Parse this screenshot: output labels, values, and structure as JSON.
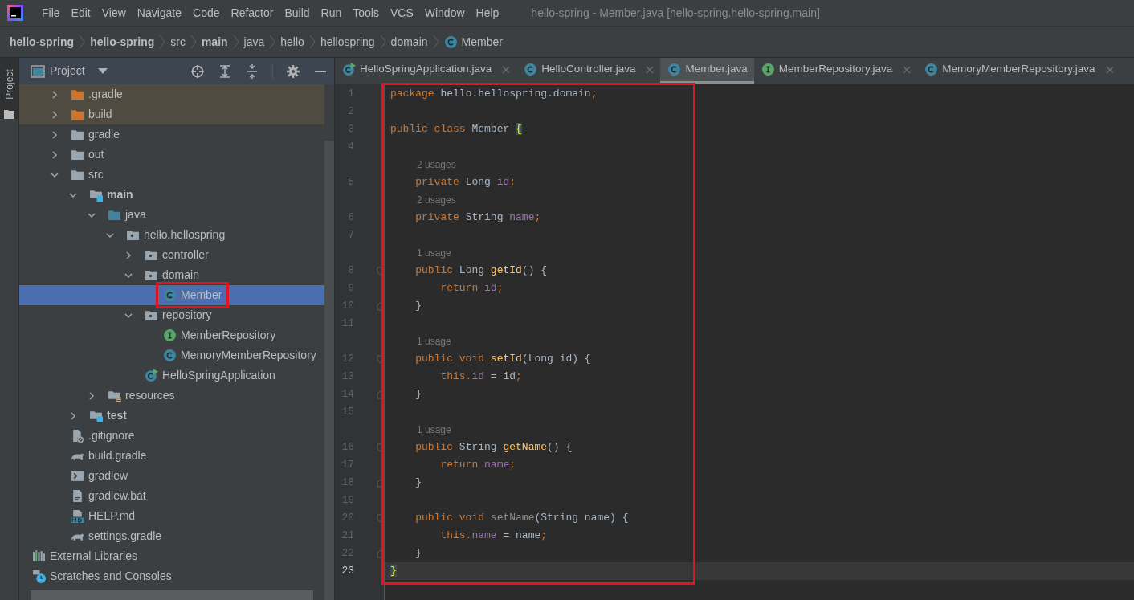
{
  "window": {
    "title": "hello-spring - Member.java [hello-spring.hello-spring.main]"
  },
  "menu": [
    "File",
    "Edit",
    "View",
    "Navigate",
    "Code",
    "Refactor",
    "Build",
    "Run",
    "Tools",
    "VCS",
    "Window",
    "Help"
  ],
  "breadcrumbs": [
    {
      "label": "hello-spring",
      "bold": true,
      "kind": "plain"
    },
    {
      "label": "hello-spring",
      "bold": true,
      "kind": "plain"
    },
    {
      "label": "src",
      "bold": false,
      "kind": "plain"
    },
    {
      "label": "main",
      "bold": true,
      "kind": "plain"
    },
    {
      "label": "java",
      "bold": false,
      "kind": "plain"
    },
    {
      "label": "hello",
      "bold": false,
      "kind": "plain"
    },
    {
      "label": "hellospring",
      "bold": false,
      "kind": "plain"
    },
    {
      "label": "domain",
      "bold": false,
      "kind": "plain"
    },
    {
      "label": "Member",
      "bold": false,
      "kind": "class"
    }
  ],
  "side_tab": {
    "label": "Project",
    "selected": true
  },
  "project_panel": {
    "title": "Project",
    "items": [
      {
        "label": ".gradle",
        "kind": "folder_excluded",
        "bold": false,
        "excluded": true,
        "selected": false,
        "framed": false,
        "expanded": false
      },
      {
        "label": "build",
        "kind": "folder_excluded",
        "bold": false,
        "excluded": true,
        "selected": false,
        "framed": false,
        "expanded": false
      },
      {
        "label": "gradle",
        "kind": "folder",
        "bold": false,
        "excluded": false,
        "selected": false,
        "framed": false,
        "expanded": false
      },
      {
        "label": "out",
        "kind": "folder",
        "bold": false,
        "excluded": false,
        "selected": false,
        "framed": false,
        "expanded": false
      },
      {
        "label": "src",
        "kind": "folder",
        "bold": false,
        "excluded": false,
        "selected": false,
        "framed": false,
        "expanded": true,
        "children": [
          {
            "label": "main",
            "kind": "folder_source",
            "bold": true,
            "excluded": false,
            "selected": false,
            "framed": false,
            "expanded": true,
            "children": [
              {
                "label": "java",
                "kind": "folder_java",
                "bold": false,
                "excluded": false,
                "selected": false,
                "framed": false,
                "expanded": true,
                "children": [
                  {
                    "label": "hello.hellospring",
                    "kind": "package",
                    "bold": false,
                    "excluded": false,
                    "selected": false,
                    "framed": false,
                    "expanded": true,
                    "children": [
                      {
                        "label": "controller",
                        "kind": "package",
                        "bold": false,
                        "excluded": false,
                        "selected": false,
                        "framed": false,
                        "expanded": false
                      },
                      {
                        "label": "domain",
                        "kind": "package",
                        "bold": false,
                        "excluded": false,
                        "selected": false,
                        "framed": false,
                        "expanded": true,
                        "children": [
                          {
                            "label": "Member",
                            "kind": "class",
                            "bold": false,
                            "excluded": false,
                            "selected": true,
                            "framed": true
                          }
                        ]
                      },
                      {
                        "label": "repository",
                        "kind": "package",
                        "bold": false,
                        "excluded": false,
                        "selected": false,
                        "framed": false,
                        "expanded": true,
                        "children": [
                          {
                            "label": "MemberRepository",
                            "kind": "interface",
                            "bold": false,
                            "excluded": false,
                            "selected": false,
                            "framed": false
                          },
                          {
                            "label": "MemoryMemberRepository",
                            "kind": "class",
                            "bold": false,
                            "excluded": false,
                            "selected": false,
                            "framed": false
                          }
                        ]
                      },
                      {
                        "label": "HelloSpringApplication",
                        "kind": "class_run",
                        "bold": false,
                        "excluded": false,
                        "selected": false,
                        "framed": false
                      }
                    ]
                  }
                ]
              },
              {
                "label": "resources",
                "kind": "folder_resources",
                "bold": false,
                "excluded": false,
                "selected": false,
                "framed": false,
                "expanded": false
              }
            ]
          },
          {
            "label": "test",
            "kind": "folder_source",
            "bold": true,
            "excluded": false,
            "selected": false,
            "framed": false,
            "expanded": false
          }
        ]
      },
      {
        "label": ".gitignore",
        "kind": "gitignore",
        "bold": false,
        "excluded": false,
        "selected": false,
        "framed": false
      },
      {
        "label": "build.gradle",
        "kind": "gradle",
        "bold": false,
        "excluded": false,
        "selected": false,
        "framed": false
      },
      {
        "label": "gradlew",
        "kind": "shell",
        "bold": false,
        "excluded": false,
        "selected": false,
        "framed": false
      },
      {
        "label": "gradlew.bat",
        "kind": "text_file",
        "bold": false,
        "excluded": false,
        "selected": false,
        "framed": false
      },
      {
        "label": "HELP.md",
        "kind": "markdown",
        "bold": false,
        "excluded": false,
        "selected": false,
        "framed": false
      },
      {
        "label": "settings.gradle",
        "kind": "gradle",
        "bold": false,
        "excluded": false,
        "selected": false,
        "framed": false
      }
    ],
    "top_level_items": [
      {
        "label": "External Libraries",
        "kind": "libraries"
      },
      {
        "label": "Scratches and Consoles",
        "kind": "scratches"
      }
    ]
  },
  "tabs": [
    {
      "label": "HelloSpringApplication.java",
      "kind": "class_run",
      "selected": false,
      "show_close": true
    },
    {
      "label": "HelloController.java",
      "kind": "class",
      "selected": false,
      "show_close": true
    },
    {
      "label": "Member.java",
      "kind": "class",
      "selected": true,
      "show_close": false
    },
    {
      "label": "MemberRepository.java",
      "kind": "interface",
      "selected": false,
      "show_close": true
    },
    {
      "label": "MemoryMemberRepository.java",
      "kind": "class",
      "selected": false,
      "show_close": true
    }
  ],
  "editor": {
    "framed": true,
    "rows": [
      {
        "kind": "code",
        "number": "1",
        "current": false,
        "tokens": [
          {
            "text": "package ",
            "kind": "keyword"
          },
          {
            "text": "hello.hellospring.domain",
            "kind": "plain"
          },
          {
            "text": ";",
            "kind": "keyword"
          }
        ]
      },
      {
        "kind": "code",
        "number": "2",
        "current": false
      },
      {
        "kind": "code",
        "number": "3",
        "current": false,
        "tokens": [
          {
            "text": "public class ",
            "kind": "keyword"
          },
          {
            "text": "Member ",
            "kind": "plain"
          },
          {
            "text": "{",
            "kind": "brace_match"
          }
        ]
      },
      {
        "kind": "code",
        "number": "4",
        "current": false
      },
      {
        "kind": "hint",
        "text": "2 usages"
      },
      {
        "kind": "code",
        "number": "5",
        "current": false,
        "tokens": [
          {
            "text": "    private ",
            "kind": "keyword"
          },
          {
            "text": "Long ",
            "kind": "plain"
          },
          {
            "text": "id",
            "kind": "field"
          },
          {
            "text": ";",
            "kind": "keyword"
          }
        ]
      },
      {
        "kind": "hint",
        "text": "2 usages"
      },
      {
        "kind": "code",
        "number": "6",
        "current": false,
        "tokens": [
          {
            "text": "    private ",
            "kind": "keyword"
          },
          {
            "text": "String ",
            "kind": "plain"
          },
          {
            "text": "name",
            "kind": "field"
          },
          {
            "text": ";",
            "kind": "keyword"
          }
        ]
      },
      {
        "kind": "code",
        "number": "7",
        "current": false
      },
      {
        "kind": "hint",
        "text": "1 usage"
      },
      {
        "kind": "fold_start",
        "number": "8",
        "current": false,
        "tokens": [
          {
            "text": "    public ",
            "kind": "keyword"
          },
          {
            "text": "Long ",
            "kind": "plain"
          },
          {
            "text": "getId",
            "kind": "method"
          },
          {
            "text": "() {",
            "kind": "plain"
          }
        ]
      },
      {
        "kind": "code",
        "number": "9",
        "current": false,
        "tokens": [
          {
            "text": "        return ",
            "kind": "keyword"
          },
          {
            "text": "id",
            "kind": "field"
          },
          {
            "text": ";",
            "kind": "keyword"
          }
        ]
      },
      {
        "kind": "fold_end",
        "number": "10",
        "current": false,
        "tokens": [
          {
            "text": "    }",
            "kind": "plain"
          }
        ]
      },
      {
        "kind": "code",
        "number": "11",
        "current": false
      },
      {
        "kind": "hint",
        "text": "1 usage"
      },
      {
        "kind": "fold_start",
        "number": "12",
        "current": false,
        "tokens": [
          {
            "text": "    public void ",
            "kind": "keyword"
          },
          {
            "text": "setId",
            "kind": "method"
          },
          {
            "text": "(Long id) {",
            "kind": "plain"
          }
        ]
      },
      {
        "kind": "code",
        "number": "13",
        "current": false,
        "tokens": [
          {
            "text": "        this.",
            "kind": "keyword"
          },
          {
            "text": "id",
            "kind": "field"
          },
          {
            "text": " = id",
            "kind": "plain"
          },
          {
            "text": ";",
            "kind": "keyword"
          }
        ]
      },
      {
        "kind": "fold_end",
        "number": "14",
        "current": false,
        "tokens": [
          {
            "text": "    }",
            "kind": "plain"
          }
        ]
      },
      {
        "kind": "code",
        "number": "15",
        "current": false
      },
      {
        "kind": "hint",
        "text": "1 usage"
      },
      {
        "kind": "fold_start",
        "number": "16",
        "current": false,
        "tokens": [
          {
            "text": "    public ",
            "kind": "keyword"
          },
          {
            "text": "String ",
            "kind": "plain"
          },
          {
            "text": "getName",
            "kind": "method"
          },
          {
            "text": "() {",
            "kind": "plain"
          }
        ]
      },
      {
        "kind": "code",
        "number": "17",
        "current": false,
        "tokens": [
          {
            "text": "        return ",
            "kind": "keyword"
          },
          {
            "text": "name",
            "kind": "field"
          },
          {
            "text": ";",
            "kind": "keyword"
          }
        ]
      },
      {
        "kind": "fold_end",
        "number": "18",
        "current": false,
        "tokens": [
          {
            "text": "    }",
            "kind": "plain"
          }
        ]
      },
      {
        "kind": "code",
        "number": "19",
        "current": false
      },
      {
        "kind": "fold_start",
        "number": "20",
        "current": false,
        "tokens": [
          {
            "text": "    public void ",
            "kind": "keyword"
          },
          {
            "text": "setName",
            "kind": "unused"
          },
          {
            "text": "(String name) {",
            "kind": "plain"
          }
        ]
      },
      {
        "kind": "code",
        "number": "21",
        "current": false,
        "tokens": [
          {
            "text": "        this.",
            "kind": "keyword"
          },
          {
            "text": "name",
            "kind": "field"
          },
          {
            "text": " = name",
            "kind": "plain"
          },
          {
            "text": ";",
            "kind": "keyword"
          }
        ]
      },
      {
        "kind": "fold_end",
        "number": "22",
        "current": false,
        "tokens": [
          {
            "text": "    }",
            "kind": "plain"
          }
        ]
      },
      {
        "kind": "code",
        "number": "23",
        "current": true,
        "tokens": [
          {
            "text": "}",
            "kind": "brace_match"
          }
        ]
      }
    ]
  }
}
